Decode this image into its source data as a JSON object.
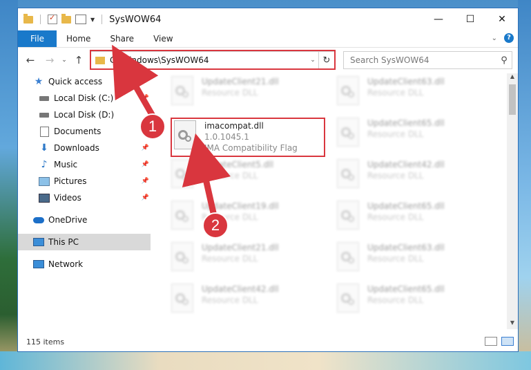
{
  "window": {
    "title": "SysWOW64"
  },
  "controls": {
    "minimize": "—",
    "maximize": "☐",
    "close": "✕"
  },
  "ribbon": {
    "tabs": [
      "File",
      "Home",
      "Share",
      "View"
    ],
    "help": "?"
  },
  "address": {
    "path": "C:\\Windows\\SysWOW64"
  },
  "search": {
    "placeholder": "Search SysWOW64"
  },
  "sidebar": {
    "items": [
      {
        "label": "Quick access",
        "icon": "star-icon",
        "pinned": false
      },
      {
        "label": "Local Disk (C:)",
        "icon": "drive-icon",
        "pinned": true
      },
      {
        "label": "Local Disk (D:)",
        "icon": "drive-icon",
        "pinned": false
      },
      {
        "label": "Documents",
        "icon": "documents-icon",
        "pinned": true
      },
      {
        "label": "Downloads",
        "icon": "downloads-icon",
        "pinned": true
      },
      {
        "label": "Music",
        "icon": "music-icon",
        "pinned": true
      },
      {
        "label": "Pictures",
        "icon": "pictures-icon",
        "pinned": true
      },
      {
        "label": "Videos",
        "icon": "videos-icon",
        "pinned": true
      },
      {
        "label": "OneDrive",
        "icon": "onedrive-icon",
        "pinned": false
      },
      {
        "label": "This PC",
        "icon": "this-pc-icon",
        "pinned": false,
        "selected": true
      },
      {
        "label": "Network",
        "icon": "network-icon",
        "pinned": false
      }
    ]
  },
  "highlighted_file": {
    "name": "imacompat.dll",
    "version": "1.0.1045.1",
    "description": "IMA Compatibility Flag"
  },
  "files": {
    "left": [
      {
        "name": "UpdateClient21.dll",
        "type": "Resource DLL"
      },
      {
        "name": "UpdateClient5.dll",
        "type": "Resource DLL"
      },
      {
        "name": "UpdateClient19.dll",
        "type": "Resource DLL"
      },
      {
        "name": "UpdateClient21.dll",
        "type": "Resource DLL"
      },
      {
        "name": "UpdateClient42.dll",
        "type": "Resource DLL"
      }
    ],
    "right": [
      {
        "name": "UpdateClient63.dll",
        "type": "Resource DLL"
      },
      {
        "name": "UpdateClient65.dll",
        "type": "Resource DLL"
      },
      {
        "name": "UpdateClient42.dll",
        "type": "Resource DLL"
      },
      {
        "name": "UpdateClient65.dll",
        "type": "Resource DLL"
      },
      {
        "name": "UpdateClient63.dll",
        "type": "Resource DLL"
      },
      {
        "name": "UpdateClient65.dll",
        "type": "Resource DLL"
      }
    ]
  },
  "status": {
    "items": "115 items"
  },
  "annotations": {
    "badge1": "1",
    "badge2": "2",
    "color": "#d9363e"
  }
}
